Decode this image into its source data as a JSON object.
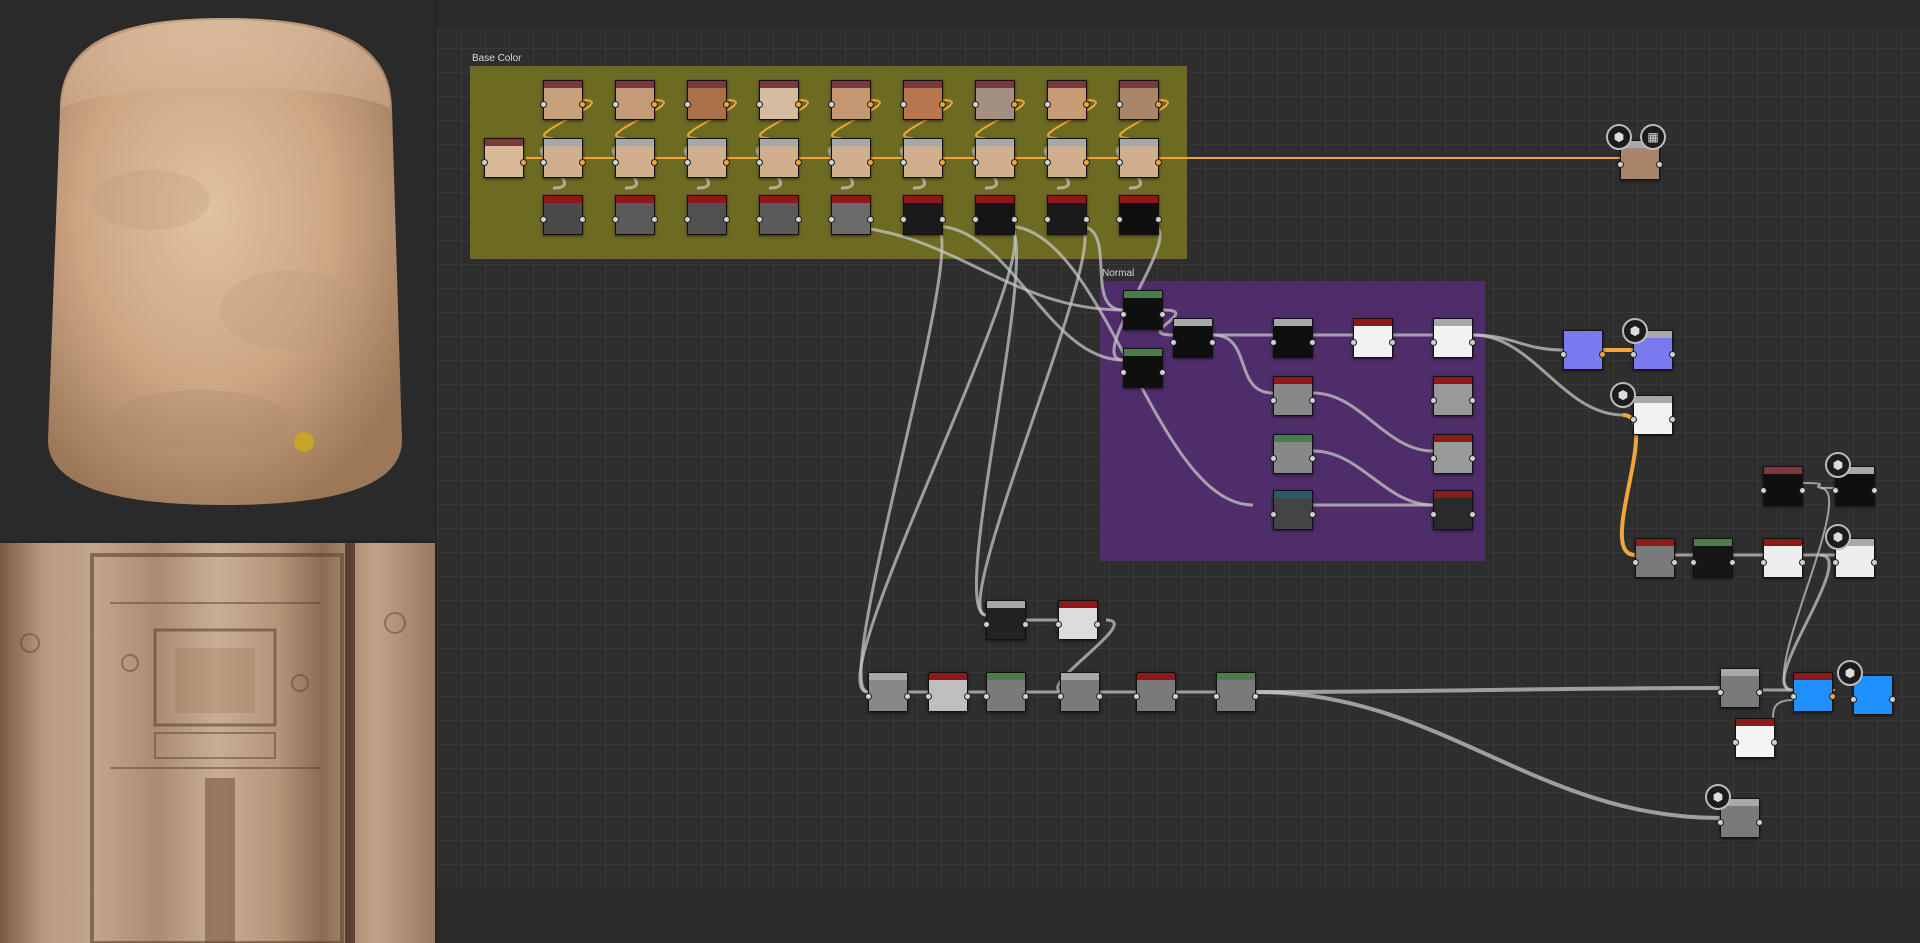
{
  "graph": {
    "frames": [
      {
        "id": "base-color",
        "label": "Base Color",
        "color": "#6d6b22"
      },
      {
        "id": "normal",
        "label": "Normal",
        "color": "#4f2d6b"
      }
    ]
  },
  "colors": {
    "wire": "#c4c4c4",
    "wire_gold": "#f0a63a",
    "header_red": "#8c1a1a",
    "header_green": "#4e7a4e",
    "header_gray": "#a8a8a8",
    "header_teal": "#2d5a62",
    "header_mauve": "#7a3840"
  },
  "icons": {
    "preview_3d": "cube-icon",
    "preview_2d": "checker-icon"
  }
}
